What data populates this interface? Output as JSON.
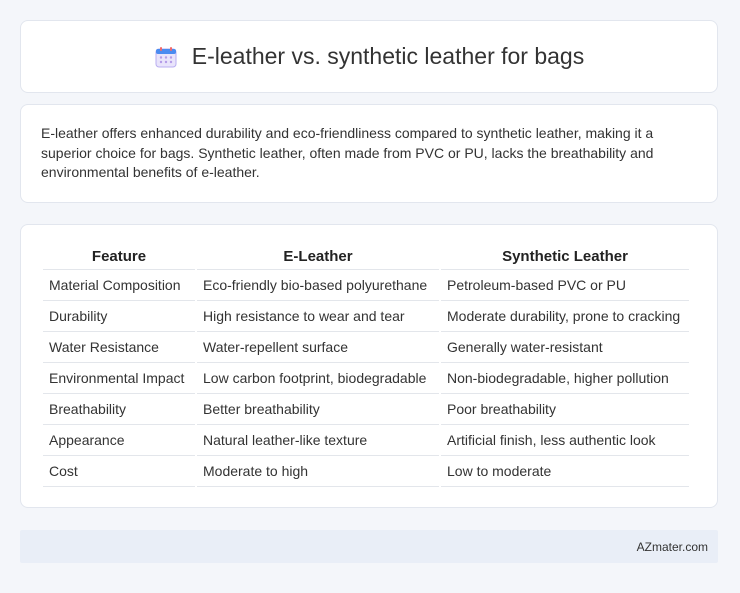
{
  "header": {
    "title": "E-leather vs. synthetic leather for bags",
    "icon": "calendar-icon"
  },
  "description": "E-leather offers enhanced durability and eco-friendliness compared to synthetic leather, making it a superior choice for bags. Synthetic leather, often made from PVC or PU, lacks the breathability and environmental benefits of e-leather.",
  "table": {
    "headers": [
      "Feature",
      "E-Leather",
      "Synthetic Leather"
    ],
    "rows": [
      [
        "Material Composition",
        "Eco-friendly bio-based polyurethane",
        "Petroleum-based PVC or PU"
      ],
      [
        "Durability",
        "High resistance to wear and tear",
        "Moderate durability, prone to cracking"
      ],
      [
        "Water Resistance",
        "Water-repellent surface",
        "Generally water-resistant"
      ],
      [
        "Environmental Impact",
        "Low carbon footprint, biodegradable",
        "Non-biodegradable, higher pollution"
      ],
      [
        "Breathability",
        "Better breathability",
        "Poor breathability"
      ],
      [
        "Appearance",
        "Natural leather-like texture",
        "Artificial finish, less authentic look"
      ],
      [
        "Cost",
        "Moderate to high",
        "Low to moderate"
      ]
    ]
  },
  "footer": {
    "brand": "AZmater.com"
  }
}
